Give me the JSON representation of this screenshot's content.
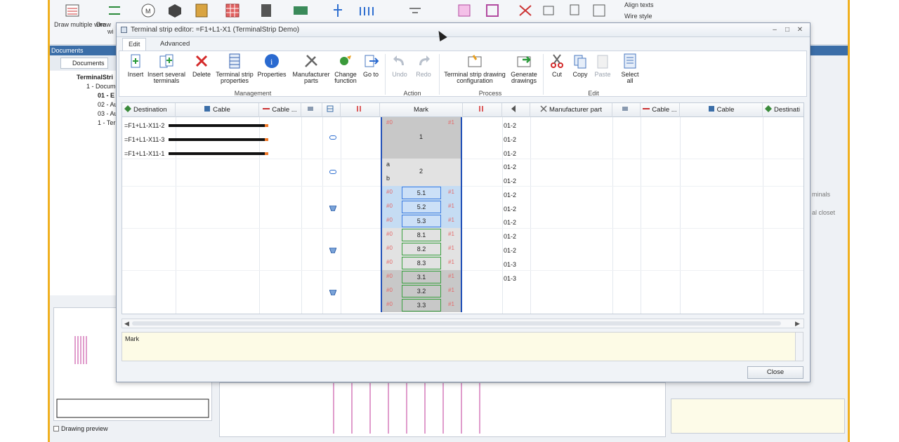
{
  "background": {
    "ribbon_labels": {
      "draw_multiple_wire": "Draw multiple wire",
      "draw_short": "Draw",
      "wi": "wi"
    },
    "align_texts": "Align texts",
    "wire_style": "Wire style",
    "docs_panel_title": "Documents",
    "docs_tab": "Documents",
    "tree": {
      "root": "TerminalStri",
      "item1": "1 - Docume",
      "item2": "01 - E",
      "item3": "02 - Au",
      "item4": "03 - Au",
      "item5": "1 - Ter"
    },
    "drawing_preview": "Drawing preview",
    "right_pane_hints": [
      "minals",
      "al closet"
    ]
  },
  "dialog": {
    "title": "Terminal strip editor: =F1+L1-X1 (TerminalStrip Demo)",
    "tabs": [
      "Edit",
      "Advanced"
    ],
    "ribbon": {
      "buttons": [
        {
          "label": "Insert",
          "icon": "insert-terminal-icon"
        },
        {
          "label": "Insert several terminals",
          "icon": "insert-several-icon"
        },
        {
          "label": "Delete",
          "icon": "delete-icon"
        },
        {
          "label": "Terminal strip properties",
          "icon": "strip-properties-icon"
        },
        {
          "label": "Properties",
          "icon": "properties-icon"
        },
        {
          "label": "Manufacturer parts",
          "icon": "manufacturer-parts-icon"
        },
        {
          "label": "Change function",
          "icon": "change-function-icon"
        },
        {
          "label": "Go to",
          "icon": "goto-icon"
        },
        {
          "label": "Undo",
          "icon": "undo-icon"
        },
        {
          "label": "Redo",
          "icon": "redo-icon"
        },
        {
          "label": "Terminal strip drawing configuration",
          "icon": "drawing-config-icon"
        },
        {
          "label": "Generate drawings",
          "icon": "generate-drawings-icon"
        },
        {
          "label": "Cut",
          "icon": "cut-icon"
        },
        {
          "label": "Copy",
          "icon": "copy-icon"
        },
        {
          "label": "Paste",
          "icon": "paste-icon"
        },
        {
          "label": "Select all",
          "icon": "select-all-icon"
        }
      ],
      "groups": [
        "Management",
        "Action",
        "Process",
        "Edit"
      ]
    },
    "grid": {
      "headers": [
        "Destination",
        "Cable",
        "Cable ...",
        "",
        "",
        "",
        "Mark",
        "",
        "",
        "Manufacturer part",
        "",
        "Cable ...",
        "Cable",
        "Destinati"
      ],
      "destinations": [
        "=F1+L1-X11-2",
        "=F1+L1-X11-3",
        "=F1+L1-X11-1"
      ],
      "mark_hash_l": "#0",
      "mark_hash_r": "#1",
      "marks": [
        "1",
        "2",
        "5.1",
        "5.2",
        "5.3",
        "8.1",
        "8.2",
        "8.3",
        "3.1",
        "3.2",
        "3.3"
      ],
      "mark_ab": [
        "a",
        "b"
      ],
      "numbers": [
        "01-2",
        "01-2",
        "01-2",
        "01-2",
        "01-2",
        "01-2",
        "01-2",
        "01-2",
        "01-2",
        "01-2",
        "01-3",
        "01-3"
      ]
    },
    "property_label": "Mark",
    "close_label": "Close"
  }
}
